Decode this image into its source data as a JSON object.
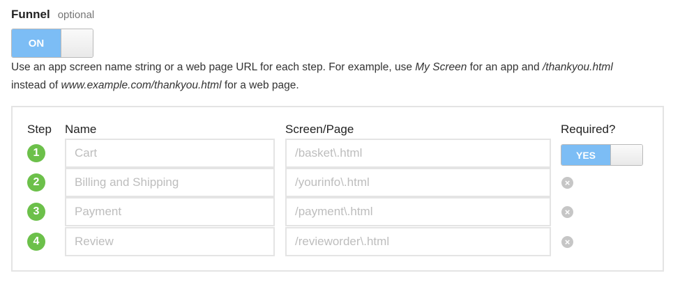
{
  "funnel": {
    "title": "Funnel",
    "optional_label": "optional",
    "toggle_label": "ON",
    "description": {
      "part1": "Use an app screen name string or a web page URL for each step. For example, use ",
      "em1": "My Screen",
      "part2": " for an app and ",
      "em2": "/thankyou.html",
      "part3": " instead of ",
      "em3": "www.example.com/thankyou.html",
      "part4": " for a web page."
    }
  },
  "table": {
    "headers": {
      "step": "Step",
      "name": "Name",
      "page": "Screen/Page",
      "required": "Required?"
    },
    "required_toggle_label": "YES",
    "steps": [
      {
        "number": "1",
        "name_placeholder": "Cart",
        "page_placeholder": "/basket\\.html"
      },
      {
        "number": "2",
        "name_placeholder": "Billing and Shipping",
        "page_placeholder": "/yourinfo\\.html"
      },
      {
        "number": "3",
        "name_placeholder": "Payment",
        "page_placeholder": "/payment\\.html"
      },
      {
        "number": "4",
        "name_placeholder": "Review",
        "page_placeholder": "/revieworder\\.html"
      }
    ]
  },
  "colors": {
    "toggle_on": "#7cbdf5",
    "step_circle": "#6cc04a",
    "remove_icon": "#c6c6c6",
    "border": "#e4e4e4"
  },
  "icons": {
    "remove": "remove-circle-x-icon"
  }
}
